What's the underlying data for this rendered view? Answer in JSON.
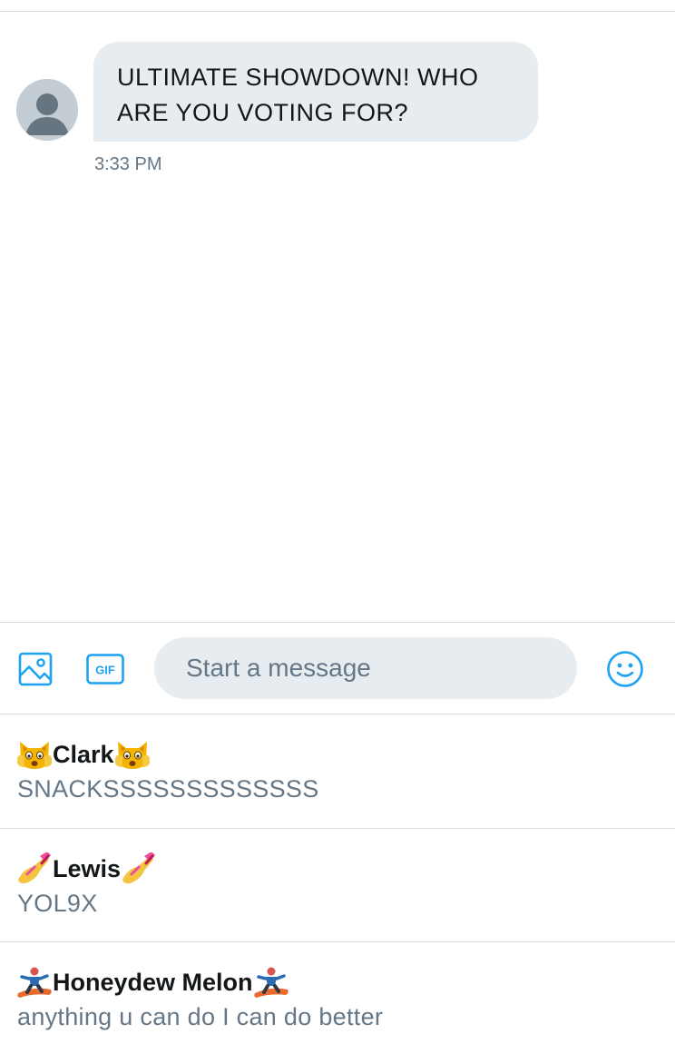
{
  "conversation": {
    "message": {
      "text_line1": "ULTIMATE SHOWDOWN! WHO",
      "text_line2": "ARE YOU VOTING FOR?",
      "timestamp": "3:33 PM"
    }
  },
  "composer": {
    "placeholder": "Start a message",
    "media_icon": "image-icon",
    "gif_label": "GIF",
    "emoji_icon": "smiley-icon"
  },
  "suggestions": [
    {
      "name": "Clark",
      "handle": "SNACKSSSSSSSSSSSSS",
      "emoji": "weary-cat-face"
    },
    {
      "name": "Lewis",
      "handle": "YOL9X",
      "emoji": "nail-polish"
    },
    {
      "name": "Honeydew Melon",
      "handle": "anything u can do I can do better",
      "emoji": "snowboarder"
    }
  ],
  "colors": {
    "accent": "#1da1f2",
    "bubble": "#e6ecf0",
    "secondary_text": "#657786",
    "divider": "#d6dbdf"
  }
}
